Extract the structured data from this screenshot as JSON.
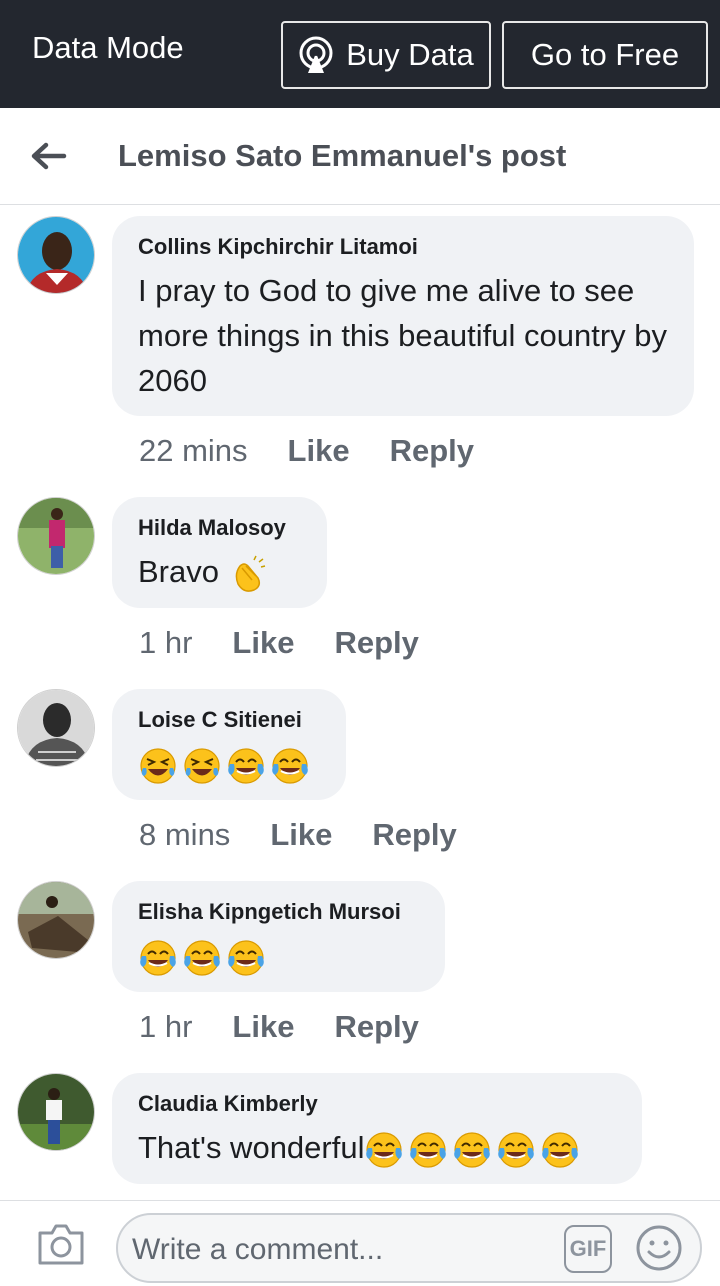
{
  "databar": {
    "mode_label": "Data Mode",
    "buy_label": "Buy Data",
    "free_label": "Go to Free"
  },
  "header": {
    "title": "Lemiso Sato Emmanuel's post"
  },
  "comments": [
    {
      "name": "Collins Kipchirchir Litamoi",
      "text": "I pray to God to give me alive to see more things in this beautiful country by 2060",
      "time": "22 mins",
      "like": "Like",
      "reply": "Reply"
    },
    {
      "name": "Hilda Malosoy",
      "text": "Bravo",
      "emojis": [
        "clapping-hands"
      ],
      "time": "1 hr",
      "like": "Like",
      "reply": "Reply"
    },
    {
      "name": "Loise C Sitienei",
      "text": "",
      "emojis": [
        "rolling-laughing",
        "rolling-laughing",
        "tears-of-joy",
        "tears-of-joy"
      ],
      "time": "8 mins",
      "like": "Like",
      "reply": "Reply"
    },
    {
      "name": "Elisha Kipngetich Mursoi",
      "text": "",
      "emojis": [
        "tears-of-joy",
        "tears-of-joy",
        "tears-of-joy"
      ],
      "time": "1 hr",
      "like": "Like",
      "reply": "Reply"
    },
    {
      "name": "Claudia Kimberly",
      "text": "That's wonderful",
      "emojis": [
        "tears-of-joy",
        "tears-of-joy",
        "tears-of-joy",
        "tears-of-joy",
        "tears-of-joy"
      ]
    }
  ],
  "composer": {
    "placeholder": "Write a comment...",
    "gif_label": "GIF"
  },
  "colors": {
    "bar_bg": "#23272f",
    "bubble_bg": "#f0f2f5",
    "meta_text": "#606770",
    "emoji_yellow": "#fcc21b"
  }
}
